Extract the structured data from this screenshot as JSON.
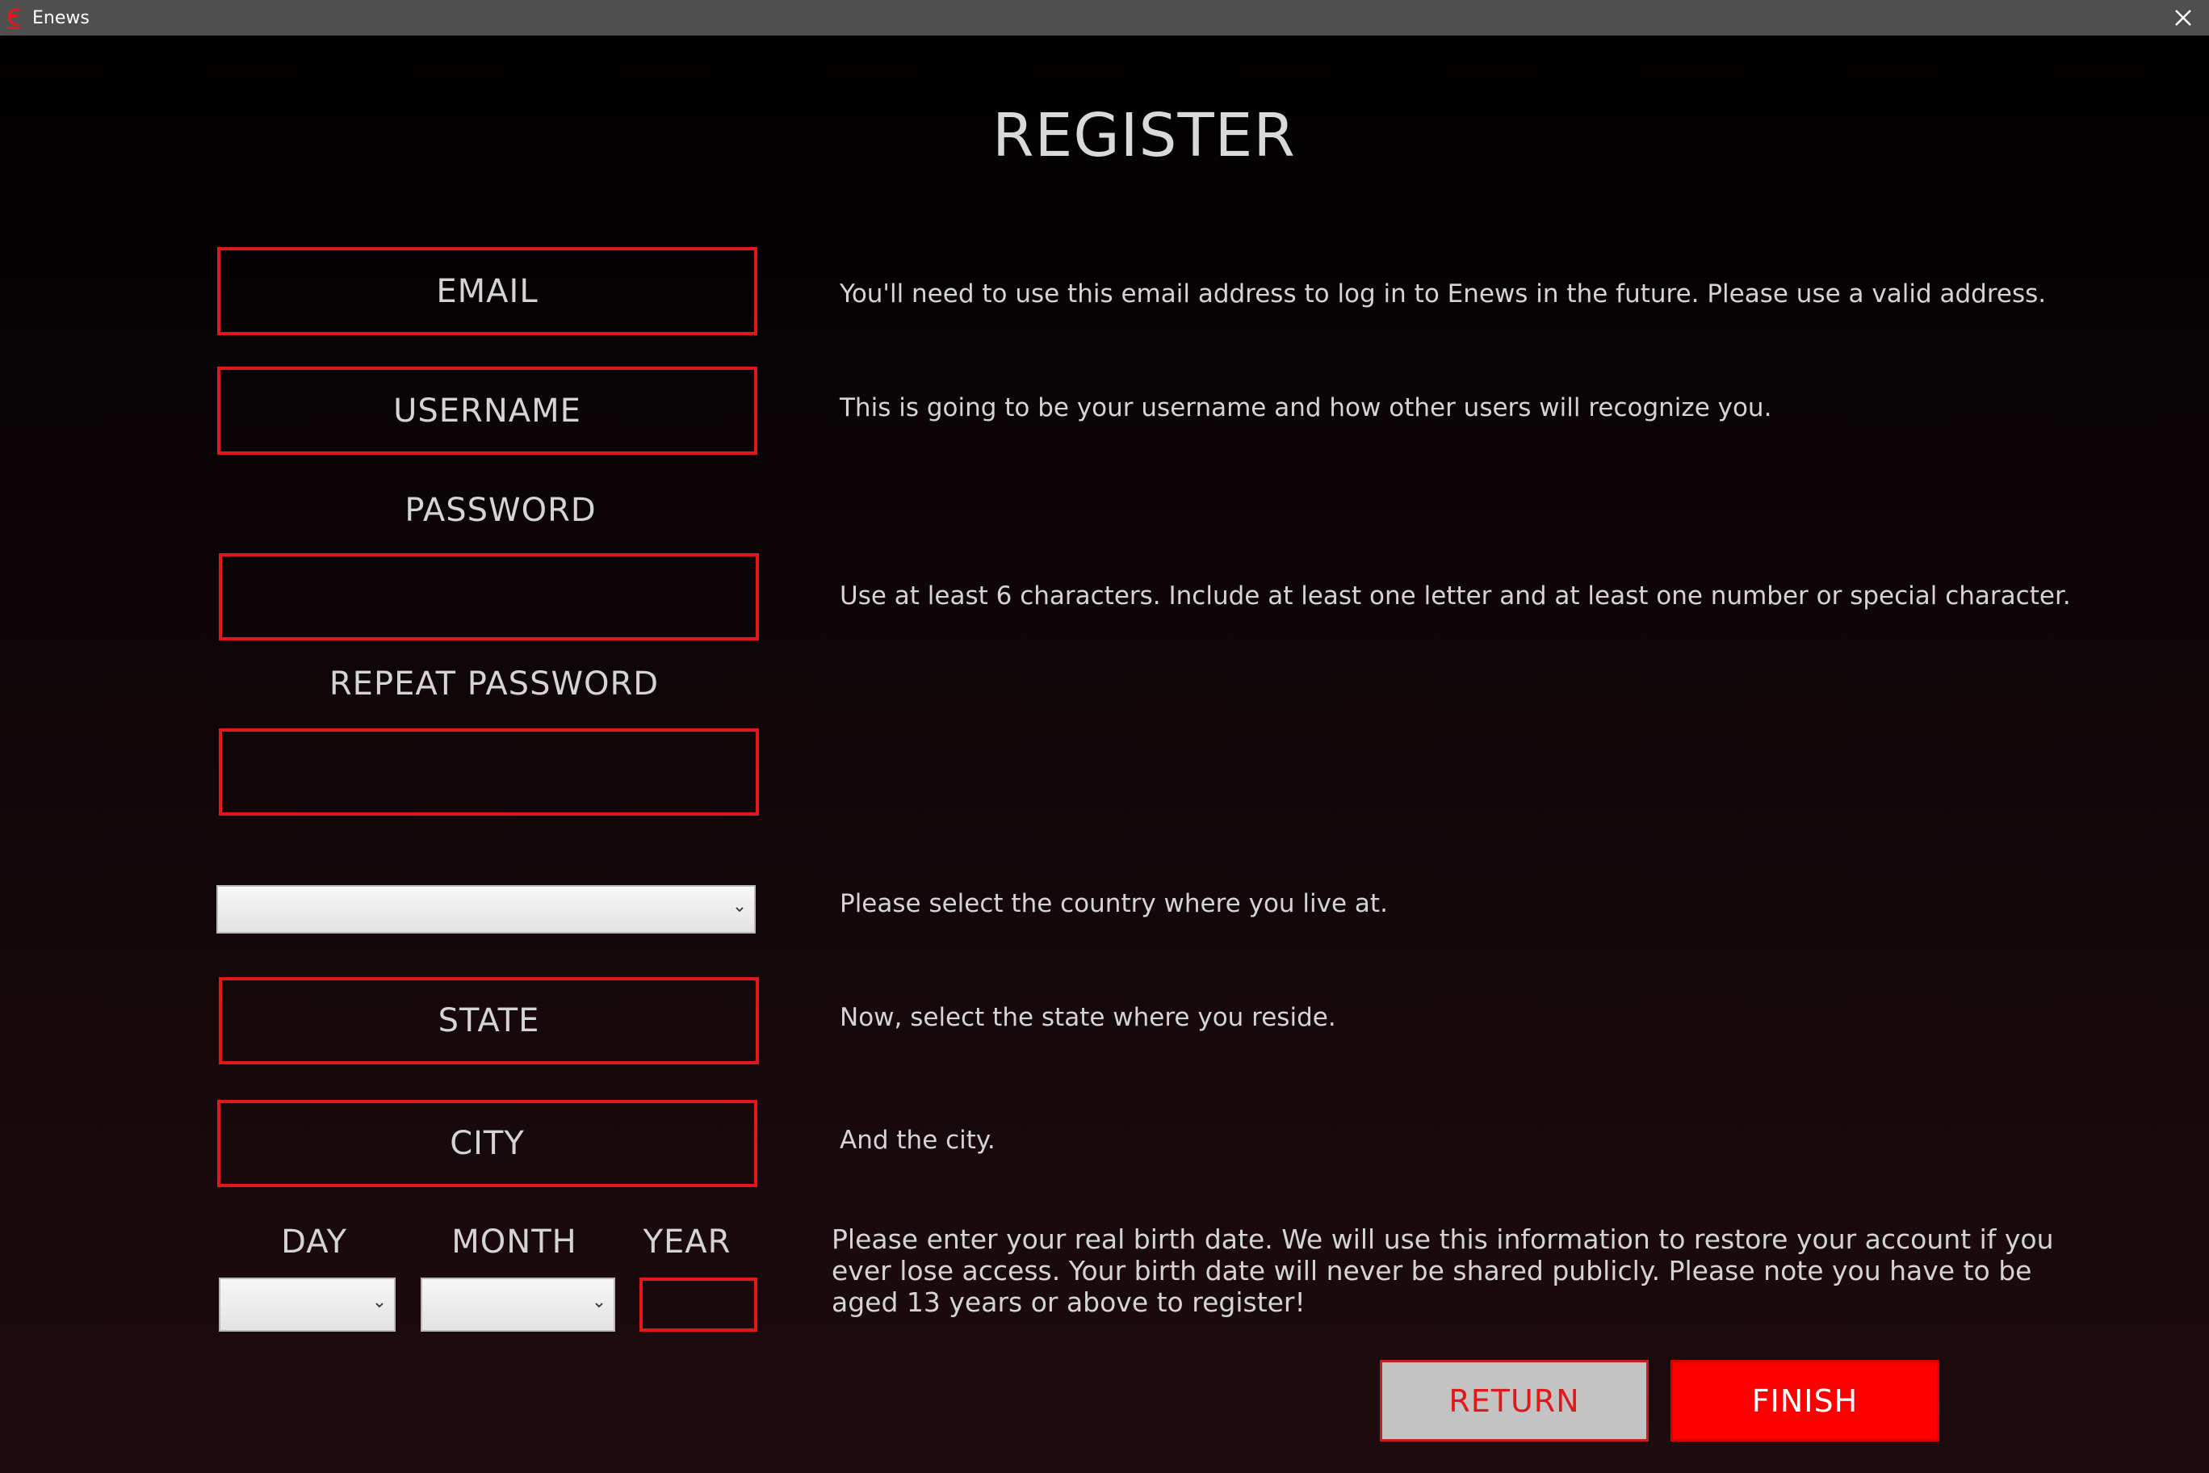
{
  "window": {
    "app_name": "Enews",
    "close_icon": "close-icon",
    "app_icon": "enews-logo-icon"
  },
  "page": {
    "title": "REGISTER"
  },
  "form": {
    "email_placeholder": "EMAIL",
    "email_hint": "You'll need to use this email address to log in to Enews in the future. Please use a valid address.",
    "username_placeholder": "USERNAME",
    "username_hint": "This is going to be your username and how other users will recognize you.",
    "password_label": "PASSWORD",
    "password_value": "",
    "password_hint": "Use at least 6 characters. Include at least one letter and at least one number or special character.",
    "repeat_password_label": "REPEAT PASSWORD",
    "repeat_password_value": "",
    "country_value": "",
    "country_hint": "Please select the country where you live at.",
    "state_placeholder": "STATE",
    "state_hint": "Now, select the state where you reside.",
    "city_placeholder": "CITY",
    "city_hint": "And the city.",
    "day_label": "DAY",
    "month_label": "MONTH",
    "year_label": "YEAR",
    "day_value": "",
    "month_value": "",
    "year_value": "",
    "birth_hint": "Please enter your real birth date. We will use this information to restore your account if you ever lose access. Your birth date will never be shared publicly. Please note you have to be aged 13 years or above to register!"
  },
  "actions": {
    "return_label": "RETURN",
    "finish_label": "FINISH"
  },
  "colors": {
    "accent": "#e3161b",
    "finish_bg": "#ff0000",
    "return_bg": "#c3c3c3",
    "titlebar": "#4f4f4f",
    "text": "#d4d4d4"
  }
}
